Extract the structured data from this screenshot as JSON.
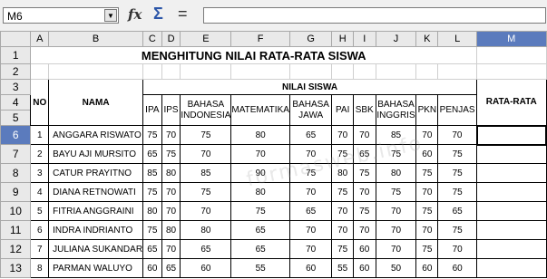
{
  "formula_bar": {
    "cell_ref": "M6",
    "formula": "",
    "dropdown_icon": "chevron-down-icon",
    "function_wizard_icon": "fx-icon",
    "sum_icon": "sigma-icon",
    "formula_icon": "equals-icon"
  },
  "columns": [
    "A",
    "B",
    "C",
    "D",
    "E",
    "F",
    "G",
    "H",
    "I",
    "J",
    "K",
    "L",
    "M"
  ],
  "rows": [
    "1",
    "2",
    "3",
    "4",
    "5",
    "6",
    "7",
    "8",
    "9",
    "10",
    "11",
    "12",
    "13"
  ],
  "sheet": {
    "title": "MENGHITUNG NILAI RATA-RATA SISWA",
    "no_header": "NO",
    "name_header": "NAMA",
    "group_header": "NILAI SISWA",
    "avg_header": "RATA-RATA",
    "subjects": [
      "IPA",
      "IPS",
      "BAHASA INDONESIA",
      "MATEMATIKA",
      "BAHASA JAWA",
      "PAI",
      "SBK",
      "BAHASA INGGRIS",
      "PKN",
      "PENJAS"
    ],
    "students": [
      {
        "no": "1",
        "name": "ANGGARA RISWATO",
        "scores": [
          "75",
          "70",
          "75",
          "80",
          "65",
          "70",
          "70",
          "85",
          "70",
          "70"
        ]
      },
      {
        "no": "2",
        "name": "BAYU AJI MURSITO",
        "scores": [
          "65",
          "75",
          "70",
          "70",
          "70",
          "75",
          "65",
          "75",
          "60",
          "75"
        ]
      },
      {
        "no": "3",
        "name": "CATUR PRAYITNO",
        "scores": [
          "85",
          "80",
          "85",
          "90",
          "75",
          "80",
          "75",
          "80",
          "75",
          "75"
        ]
      },
      {
        "no": "4",
        "name": "DIANA RETNOWATI",
        "scores": [
          "75",
          "70",
          "75",
          "80",
          "70",
          "75",
          "70",
          "75",
          "70",
          "75"
        ]
      },
      {
        "no": "5",
        "name": "FITRIA ANGGRAINI",
        "scores": [
          "80",
          "70",
          "70",
          "75",
          "65",
          "70",
          "75",
          "70",
          "75",
          "65"
        ]
      },
      {
        "no": "6",
        "name": "INDRA INDRIANTO",
        "scores": [
          "75",
          "80",
          "80",
          "65",
          "70",
          "70",
          "70",
          "70",
          "70",
          "75"
        ]
      },
      {
        "no": "7",
        "name": "JULIANA SUKANDAR",
        "scores": [
          "65",
          "70",
          "65",
          "65",
          "70",
          "75",
          "60",
          "70",
          "75",
          "70"
        ]
      },
      {
        "no": "8",
        "name": "PARMAN WALUYO",
        "scores": [
          "60",
          "65",
          "60",
          "55",
          "60",
          "55",
          "60",
          "50",
          "60",
          "60"
        ]
      }
    ]
  },
  "watermark": "formasweb.info"
}
